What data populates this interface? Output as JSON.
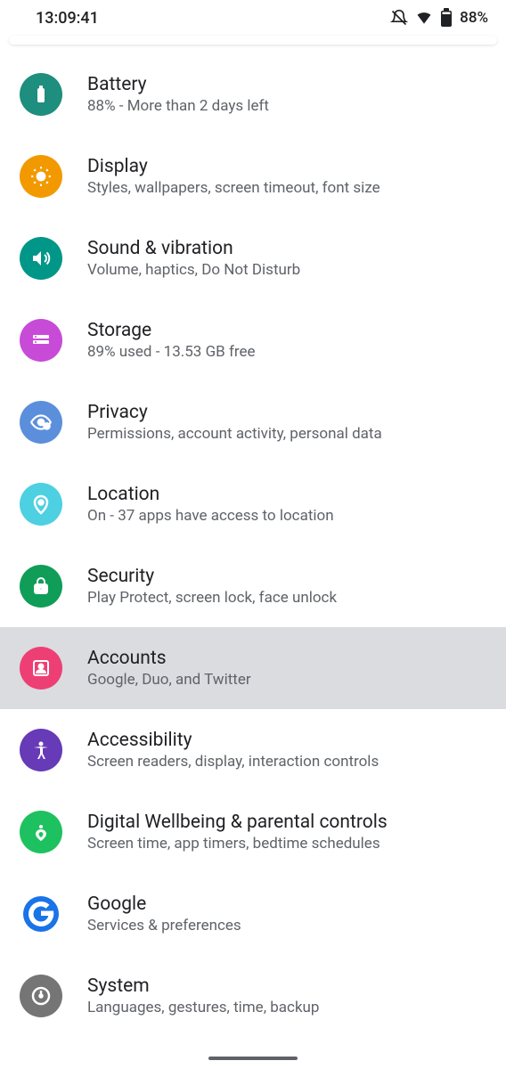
{
  "status": {
    "time": "13:09:41",
    "battery": "88%"
  },
  "items": [
    {
      "title": "Battery",
      "subtitle": "88% - More than 2 days left",
      "color": "#1e8e7e",
      "icon": "battery"
    },
    {
      "title": "Display",
      "subtitle": "Styles, wallpapers, screen timeout, font size",
      "color": "#f29900",
      "icon": "brightness"
    },
    {
      "title": "Sound & vibration",
      "subtitle": "Volume, haptics, Do Not Disturb",
      "color": "#009688",
      "icon": "sound"
    },
    {
      "title": "Storage",
      "subtitle": "89% used - 13.53 GB free",
      "color": "#c84bd8",
      "icon": "storage"
    },
    {
      "title": "Privacy",
      "subtitle": "Permissions, account activity, personal data",
      "color": "#5c8fdb",
      "icon": "privacy"
    },
    {
      "title": "Location",
      "subtitle": "On - 37 apps have access to location",
      "color": "#4dd0e1",
      "icon": "location"
    },
    {
      "title": "Security",
      "subtitle": "Play Protect, screen lock, face unlock",
      "color": "#0f9d58",
      "icon": "security"
    },
    {
      "title": "Accounts",
      "subtitle": "Google, Duo, and Twitter",
      "color": "#ee3f74",
      "icon": "accounts",
      "highlighted": true
    },
    {
      "title": "Accessibility",
      "subtitle": "Screen readers, display, interaction controls",
      "color": "#673ab7",
      "icon": "accessibility"
    },
    {
      "title": "Digital Wellbeing & parental controls",
      "subtitle": "Screen time, app timers, bedtime schedules",
      "color": "#1ec15f",
      "icon": "wellbeing"
    },
    {
      "title": "Google",
      "subtitle": "Services & preferences",
      "color": "#ffffff",
      "icon": "google"
    },
    {
      "title": "System",
      "subtitle": "Languages, gestures, time, backup",
      "color": "#757575",
      "icon": "system"
    }
  ]
}
